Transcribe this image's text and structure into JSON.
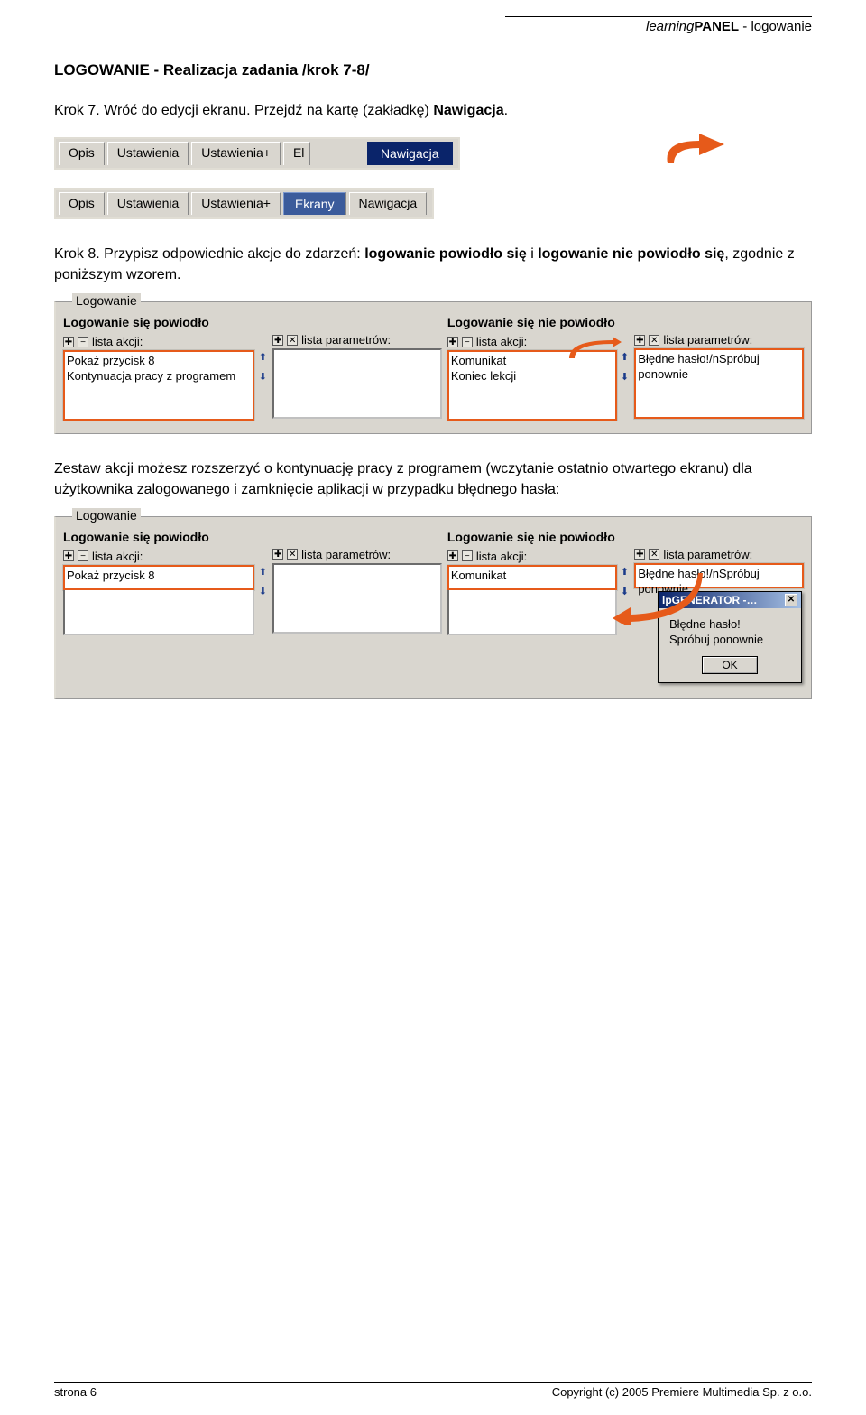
{
  "header": {
    "left": "learning",
    "mid": "PANEL",
    "right": " - logowanie"
  },
  "title": "LOGOWANIE - Realizacja zadania /krok 7-8/",
  "para1": {
    "a": "Krok 7. Wróć do edycji ekranu. Przejdź na kartę (zakładkę) ",
    "b": "Nawigacja",
    "c": "."
  },
  "tabs1": {
    "items": [
      "Opis",
      "Ustawienia",
      "Ustawienia+",
      "El"
    ],
    "selected": "Nawigacja"
  },
  "tabs2": {
    "items": [
      "Opis",
      "Ustawienia",
      "Ustawienia+"
    ],
    "selected": "Ekrany",
    "after": [
      "Nawigacja"
    ]
  },
  "para2": {
    "a": "Krok 8. Przypisz odpowiednie akcje do zdarzeń: ",
    "b": "logowanie powiodło się",
    "c": " i ",
    "d": "logowanie nie powiodło się",
    "e": ", zgodnie z poniższym wzorem."
  },
  "group": {
    "title": "Logowanie",
    "success": {
      "header": "Logowanie się powiodło",
      "list_label": "lista akcji:",
      "params_label": "lista parametrów:",
      "items": [
        "Pokaż przycisk 8",
        "Kontynuacja pracy z programem"
      ],
      "items_short": [
        "Pokaż przycisk 8"
      ]
    },
    "fail": {
      "header": "Logowanie się nie powiodło",
      "list_label": "lista akcji:",
      "params_label": "lista parametrów:",
      "items": [
        "Komunikat",
        "Koniec lekcji"
      ],
      "items_short": [
        "Komunikat"
      ],
      "param_value": "Błędne hasło!/nSpróbuj ponownie"
    }
  },
  "para3": "Zestaw akcji możesz rozszerzyć o kontynuację pracy z programem (wczytanie ostatnio otwartego ekranu) dla użytkownika zalogowanego i zamknięcie aplikacji w przypadku błędnego hasła:",
  "dialog": {
    "title": "lpGENERATOR -…",
    "line1": "Błędne hasło!",
    "line2": "Spróbuj ponownie",
    "ok": "OK"
  },
  "footer": {
    "page": "strona 6",
    "copy": "Copyright (c) 2005 Premiere Multimedia Sp. z o.o."
  }
}
